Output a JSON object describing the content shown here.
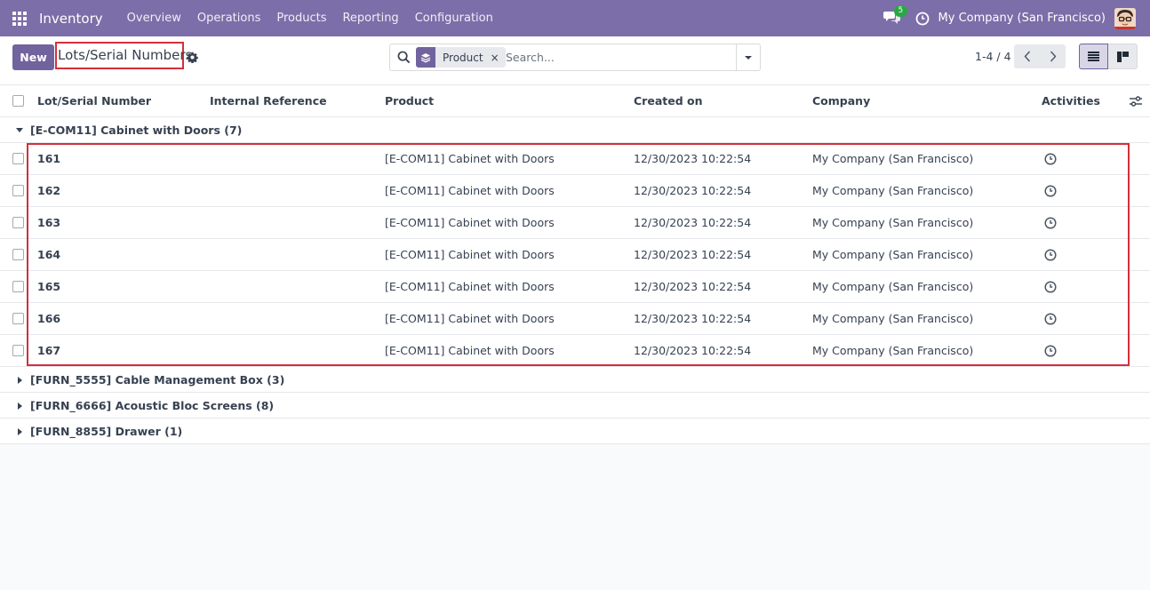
{
  "navbar": {
    "app_name": "Inventory",
    "menu": [
      "Overview",
      "Operations",
      "Products",
      "Reporting",
      "Configuration"
    ],
    "chat_badge": "5",
    "company": "My Company (San Francisco)"
  },
  "control": {
    "new_label": "New",
    "title": "Lots/Serial Numbers",
    "facet_value": "Product",
    "facet_close": "×",
    "search_placeholder": "Search...",
    "pager": "1-4 / 4"
  },
  "table": {
    "columns": [
      "Lot/Serial Number",
      "Internal Reference",
      "Product",
      "Created on",
      "Company",
      "Activities"
    ],
    "groups": [
      {
        "label": "[E-COM11] Cabinet with Doors (7)",
        "expanded": true,
        "rows": [
          {
            "lot": "161",
            "ref": "",
            "product": "[E-COM11] Cabinet with Doors",
            "created": "12/30/2023 10:22:54",
            "company": "My Company (San Francisco)"
          },
          {
            "lot": "162",
            "ref": "",
            "product": "[E-COM11] Cabinet with Doors",
            "created": "12/30/2023 10:22:54",
            "company": "My Company (San Francisco)"
          },
          {
            "lot": "163",
            "ref": "",
            "product": "[E-COM11] Cabinet with Doors",
            "created": "12/30/2023 10:22:54",
            "company": "My Company (San Francisco)"
          },
          {
            "lot": "164",
            "ref": "",
            "product": "[E-COM11] Cabinet with Doors",
            "created": "12/30/2023 10:22:54",
            "company": "My Company (San Francisco)"
          },
          {
            "lot": "165",
            "ref": "",
            "product": "[E-COM11] Cabinet with Doors",
            "created": "12/30/2023 10:22:54",
            "company": "My Company (San Francisco)"
          },
          {
            "lot": "166",
            "ref": "",
            "product": "[E-COM11] Cabinet with Doors",
            "created": "12/30/2023 10:22:54",
            "company": "My Company (San Francisco)"
          },
          {
            "lot": "167",
            "ref": "",
            "product": "[E-COM11] Cabinet with Doors",
            "created": "12/30/2023 10:22:54",
            "company": "My Company (San Francisco)"
          }
        ]
      },
      {
        "label": "[FURN_5555] Cable Management Box (3)",
        "expanded": false,
        "rows": []
      },
      {
        "label": "[FURN_6666] Acoustic Bloc Screens (8)",
        "expanded": false,
        "rows": []
      },
      {
        "label": "[FURN_8855] Drawer (1)",
        "expanded": false,
        "rows": []
      }
    ]
  },
  "icons": {
    "apps": "apps-grid-icon",
    "chat": "chat-bubbles-icon",
    "clock": "clock-icon",
    "gear": "gear-icon",
    "search": "search-icon",
    "facet": "layers-icon",
    "caret": "caret-down-icon",
    "prev": "chevron-left-icon",
    "next": "chevron-right-icon",
    "list_view": "list-view-icon",
    "kanban_view": "kanban-view-icon",
    "column_options": "sliders-icon",
    "activity": "clock-icon"
  },
  "colors": {
    "navbar": "#7c6ea8",
    "primary": "#71639e",
    "highlight": "#d32f3b",
    "badge": "#28a745"
  }
}
